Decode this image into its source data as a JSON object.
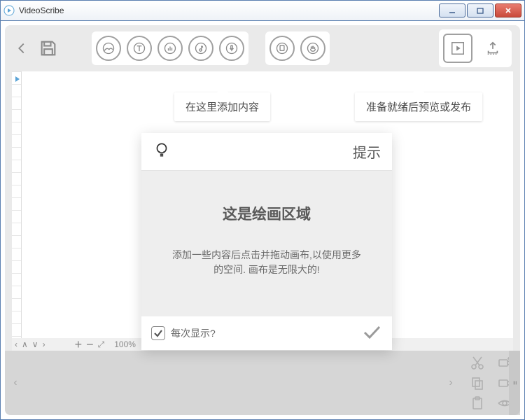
{
  "window": {
    "title": "VideoScribe"
  },
  "tooltips": {
    "add_content": "在这里添加内容",
    "preview_publish": "准备就绪后预览或发布"
  },
  "modal": {
    "title": "提示",
    "heading": "这是绘画区域",
    "body_line1": "添加一些内容后点击并拖动画布,以使用更多",
    "body_line2": "的空间. 画布是无限大的!",
    "checkbox_label": "每次显示?",
    "checkbox_checked": true
  },
  "statusbar": {
    "zoom": "100%"
  }
}
